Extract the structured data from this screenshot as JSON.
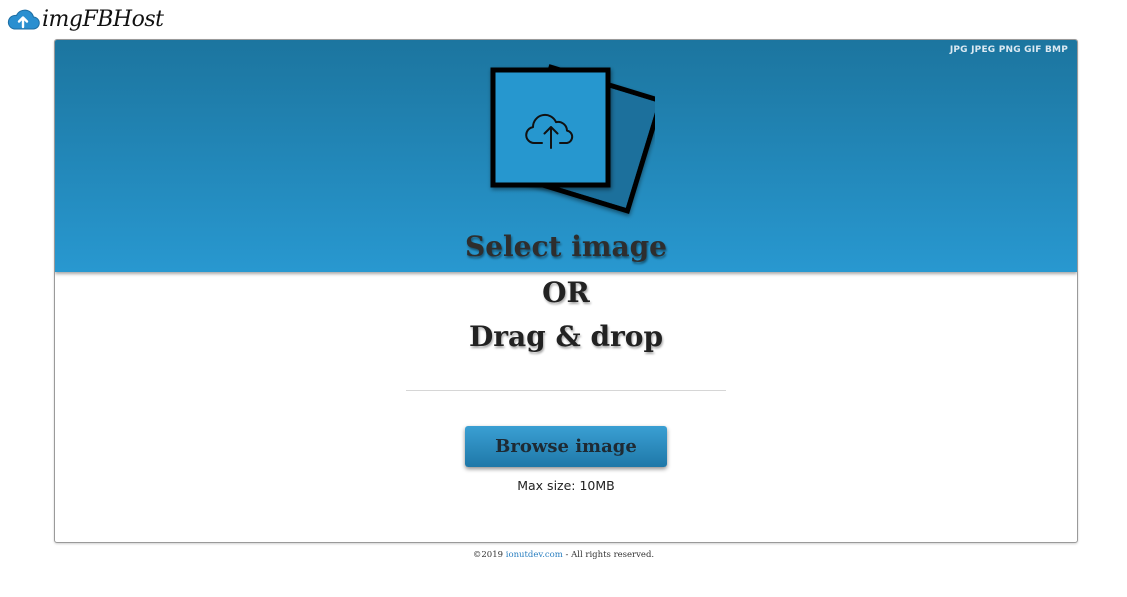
{
  "app": {
    "logo_text": "imgFBHost"
  },
  "dropzone": {
    "formats": "JPG JPEG PNG GIF BMP",
    "select_label": "Select image",
    "icon": "cloud-upload-icon"
  },
  "main": {
    "or_label": "OR",
    "drag_label": "Drag & drop",
    "browse_label": "Browse image",
    "max_size": "Max size: 10MB"
  },
  "footer": {
    "prefix": "©2019 ",
    "link_text": "ionutdev.com",
    "suffix": " - All rights reserved."
  },
  "colors": {
    "header_top": "#1c759f",
    "header_bottom": "#2898d0",
    "button": "#2b8cc1",
    "link": "#2a7fc0"
  }
}
